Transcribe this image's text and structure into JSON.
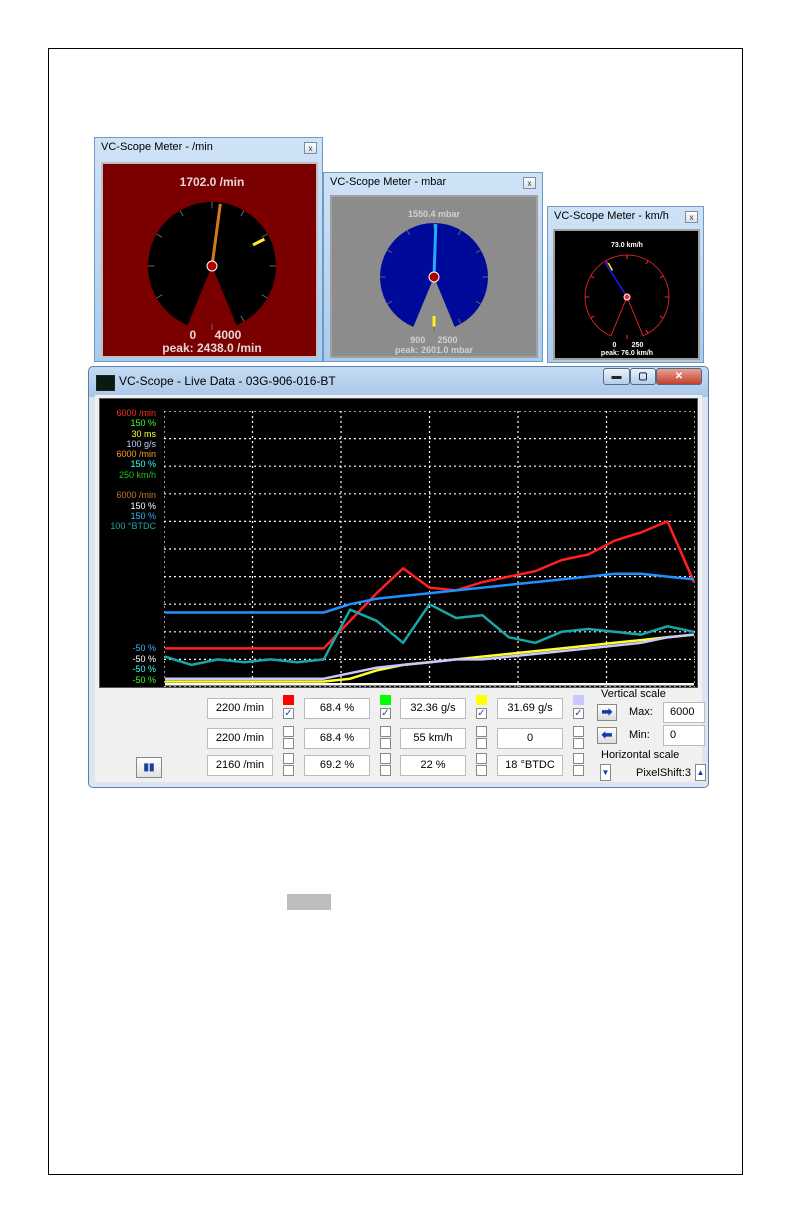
{
  "meters": [
    {
      "title": "VC-Scope Meter - /min",
      "close": "x",
      "value": "1702.0 /min",
      "range_min": "0",
      "range_max": "4000",
      "peak": "peak: 2438.0 /min",
      "level": 0.4255,
      "peak_level": 0.6095,
      "face_color": "#7a0000"
    },
    {
      "title": "VC-Scope Meter - mbar",
      "close": "x",
      "value": "1550.4 mbar",
      "range_min": "900",
      "range_max": "2500",
      "peak": "peak: 2601.0 mbar",
      "level": 0.4065,
      "peak_level": 1.0,
      "face_color": "#8c8c8c"
    },
    {
      "title": "VC-Scope Meter - km/h",
      "close": "x",
      "value": "73.0 km/h",
      "range_min": "0",
      "range_max": "250",
      "peak": "peak: 76.0 km/h",
      "level": 0.292,
      "peak_level": 0.304,
      "face_color": "#000000"
    }
  ],
  "main_window": {
    "title": "VC-Scope  -  Live Data  -  03G-906-016-BT",
    "minimize": "▬",
    "maximize": "▢",
    "close": "✕",
    "legend_top": [
      {
        "text": "6000 /min",
        "color": "#ff2a2a"
      },
      {
        "text": "150 %",
        "color": "#33ff33"
      },
      {
        "text": "30 ms",
        "color": "#ffff33"
      },
      {
        "text": "100 g/s",
        "color": "#c8c8ff"
      },
      {
        "text": "6000 /min",
        "color": "#ff9a33"
      },
      {
        "text": "150 %",
        "color": "#33ffff"
      },
      {
        "text": "250 km/h",
        "color": "#22c022"
      },
      {
        "text": "",
        "color": "#000000"
      },
      {
        "text": "6000 /min",
        "color": "#c07830"
      },
      {
        "text": "150 %",
        "color": "#ffffff"
      },
      {
        "text": "150 %",
        "color": "#3ab0ff"
      },
      {
        "text": "100 °BTDC",
        "color": "#1aa6a6"
      }
    ],
    "legend_bottom": [
      {
        "text": "-50 %",
        "color": "#3ab0ff"
      },
      {
        "text": "-50 %",
        "color": "#ffffff"
      },
      {
        "text": "-50 %",
        "color": "#33ffff"
      },
      {
        "text": "-50 %",
        "color": "#33ff33"
      }
    ],
    "readouts": [
      [
        "2200 /min",
        "68.4 %",
        "32.36 g/s",
        "31.69 g/s"
      ],
      [
        "2200 /min",
        "68.4 %",
        "55 km/h",
        "0"
      ],
      [
        "2160 /min",
        "69.2 %",
        "22 %",
        "18 °BTDC"
      ]
    ],
    "row_checked": [
      [
        true,
        true,
        true,
        true
      ],
      [
        false,
        false,
        false,
        false
      ],
      [
        false,
        false,
        false,
        false
      ]
    ],
    "swatches": [
      "#ff0000",
      "#00ff00",
      "#ffff00",
      "#c8c8ff"
    ],
    "vertical_scale": {
      "label": "Vertical scale",
      "max_label": "Max:",
      "max_value": "6000",
      "min_label": "Min:",
      "min_value": "0"
    },
    "horizontal_scale": {
      "label": "Horizontal scale",
      "pixel_shift": "PixelShift:3"
    },
    "pause": "▮▮"
  },
  "chart_data": {
    "type": "line",
    "x": [
      0,
      5,
      10,
      15,
      20,
      25,
      30,
      35,
      40,
      45,
      50,
      55,
      60,
      65,
      70,
      75,
      80,
      85,
      90,
      95,
      100
    ],
    "grid": true,
    "series": [
      {
        "color": "#ff2020",
        "values": [
          14,
          14,
          14,
          14,
          14,
          14,
          14,
          24,
          34,
          43,
          36,
          35,
          38,
          40,
          42,
          46,
          48,
          53,
          56,
          60,
          38
        ]
      },
      {
        "color": "#2090ff",
        "values": [
          27,
          27,
          27,
          27,
          27,
          27,
          27,
          30,
          32,
          33,
          34,
          35,
          36,
          37,
          38,
          39,
          40,
          41,
          41,
          40,
          39
        ]
      },
      {
        "color": "#1aa6a6",
        "values": [
          11,
          8,
          10,
          9,
          10,
          9,
          10,
          28,
          24,
          16,
          30,
          25,
          26,
          18,
          16,
          20,
          21,
          20,
          19,
          22,
          20
        ]
      },
      {
        "color": "#ffff30",
        "values": [
          2,
          2,
          2,
          2,
          2,
          2,
          2,
          3,
          6,
          8,
          9,
          10,
          11,
          12,
          13,
          14,
          15,
          16,
          17,
          18,
          19
        ]
      },
      {
        "color": "#c8c8ff",
        "values": [
          3,
          3,
          3,
          3,
          3,
          3,
          3,
          5,
          7,
          8,
          9,
          10,
          10,
          11,
          12,
          13,
          14,
          15,
          16,
          18,
          19
        ]
      },
      {
        "color": "#ffffff",
        "values": [
          1,
          1,
          1,
          1,
          1,
          1,
          1,
          1,
          1,
          1,
          1,
          1,
          1,
          1,
          1,
          1,
          1,
          1,
          1,
          1,
          1
        ]
      }
    ],
    "ylim": [
      0,
      100
    ]
  }
}
